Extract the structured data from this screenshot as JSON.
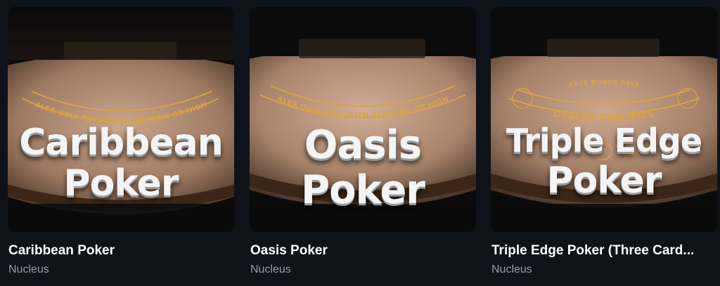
{
  "games": [
    {
      "title": "Caribbean Poker",
      "provider": "Nucleus",
      "art_line1": "Caribbean",
      "art_line2": "Poker",
      "felt_text": "DEALER ONLY PAYS WITH ACE/KING OR HIGHER"
    },
    {
      "title": "Oasis Poker",
      "provider": "Nucleus",
      "art_line1": "Oasis",
      "art_line2": "Poker",
      "felt_text": "DEALER QUALIFIES WITH ACE/KING OR HIGHER"
    },
    {
      "title": "Triple Edge Poker (Three Card...",
      "provider": "Nucleus",
      "art_line1": "Triple Edge",
      "art_line2": "Poker",
      "felt_text": "DEALER QUALIFIES",
      "felt_text_top": "ANTE BONUS PAYS"
    }
  ],
  "colors": {
    "background": "#10121a",
    "felt": "#b9947a",
    "gold_text": "#d8a24a"
  }
}
